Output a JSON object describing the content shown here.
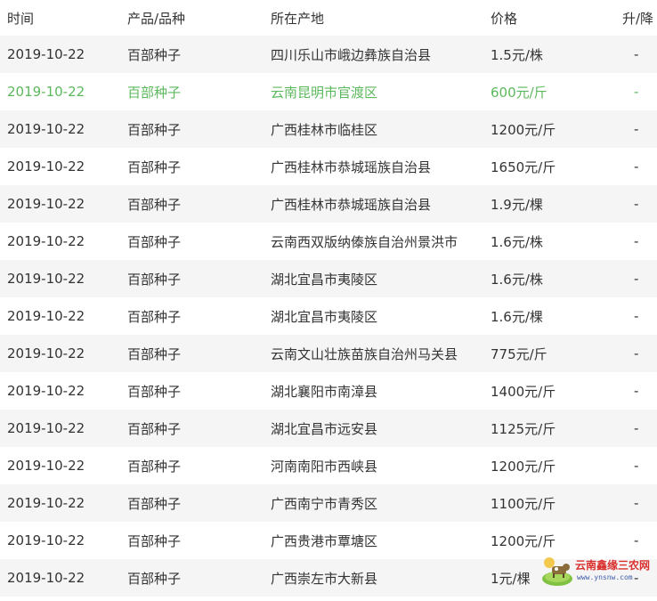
{
  "table": {
    "headers": {
      "time": "时间",
      "product": "产品/品种",
      "location": "所在产地",
      "price": "价格",
      "change": "升/降"
    },
    "rows": [
      {
        "time": "2019-10-22",
        "product": "百部种子",
        "location": "四川乐山市峨边彝族自治县",
        "price": "1.5元/株",
        "change": "-"
      },
      {
        "time": "2019-10-22",
        "product": "百部种子",
        "location": "云南昆明市官渡区",
        "price": "600元/斤",
        "change": "-"
      },
      {
        "time": "2019-10-22",
        "product": "百部种子",
        "location": "广西桂林市临桂区",
        "price": "1200元/斤",
        "change": "-"
      },
      {
        "time": "2019-10-22",
        "product": "百部种子",
        "location": "广西桂林市恭城瑶族自治县",
        "price": "1650元/斤",
        "change": "-"
      },
      {
        "time": "2019-10-22",
        "product": "百部种子",
        "location": "广西桂林市恭城瑶族自治县",
        "price": "1.9元/棵",
        "change": "-"
      },
      {
        "time": "2019-10-22",
        "product": "百部种子",
        "location": "云南西双版纳傣族自治州景洪市",
        "price": "1.6元/株",
        "change": "-"
      },
      {
        "time": "2019-10-22",
        "product": "百部种子",
        "location": "湖北宜昌市夷陵区",
        "price": "1.6元/株",
        "change": "-"
      },
      {
        "time": "2019-10-22",
        "product": "百部种子",
        "location": "湖北宜昌市夷陵区",
        "price": "1.6元/棵",
        "change": "-"
      },
      {
        "time": "2019-10-22",
        "product": "百部种子",
        "location": "云南文山壮族苗族自治州马关县",
        "price": "775元/斤",
        "change": "-"
      },
      {
        "time": "2019-10-22",
        "product": "百部种子",
        "location": "湖北襄阳市南漳县",
        "price": "1400元/斤",
        "change": "-"
      },
      {
        "time": "2019-10-22",
        "product": "百部种子",
        "location": "湖北宜昌市远安县",
        "price": "1125元/斤",
        "change": "-"
      },
      {
        "time": "2019-10-22",
        "product": "百部种子",
        "location": "河南南阳市西峡县",
        "price": "1200元/斤",
        "change": "-"
      },
      {
        "time": "2019-10-22",
        "product": "百部种子",
        "location": "广西南宁市青秀区",
        "price": "1100元/斤",
        "change": "-"
      },
      {
        "time": "2019-10-22",
        "product": "百部种子",
        "location": "广西贵港市覃塘区",
        "price": "1200元/斤",
        "change": "-"
      },
      {
        "time": "2019-10-22",
        "product": "百部种子",
        "location": "广西崇左市大新县",
        "price": "1元/棵",
        "change": "-"
      }
    ],
    "highlight_row_index": 1,
    "colors": {
      "highlight_text": "#5cb85c",
      "stripe": "#f5f5f5",
      "text": "#333333"
    }
  },
  "watermark": {
    "title": "云南鑫缘三农网",
    "url": "www.ynsnw.com",
    "icon": "cow-in-field-logo",
    "title_color": "#d9302e",
    "url_color": "#3d5aa8"
  }
}
